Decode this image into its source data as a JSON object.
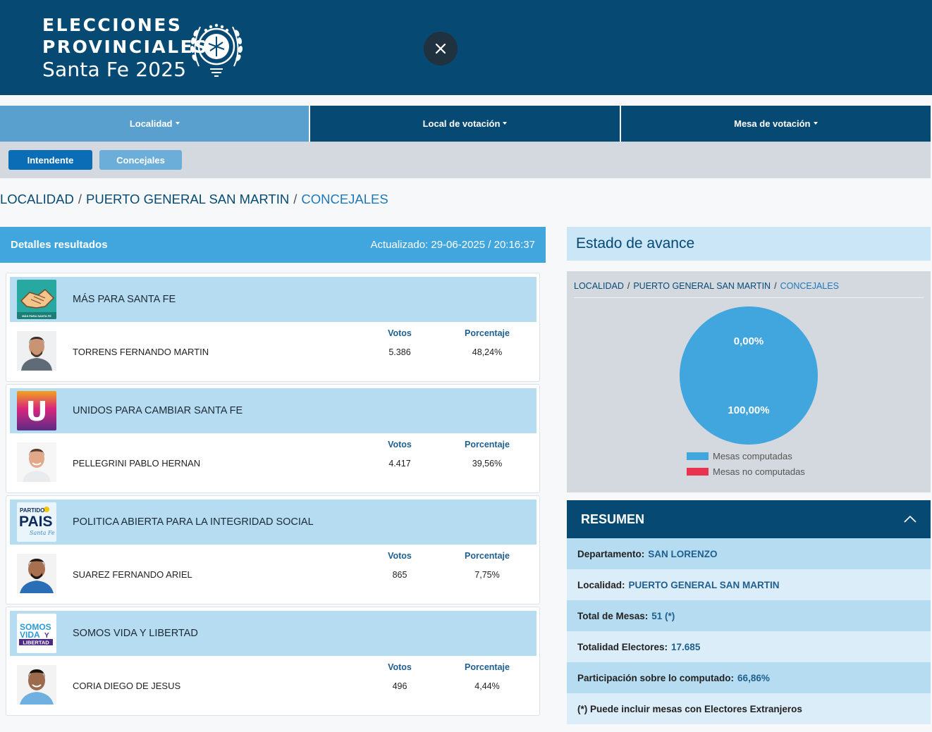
{
  "header": {
    "logo_line1": "ELECCIONES",
    "logo_line2": "PROVINCIALES",
    "logo_line3": "Santa Fe 2025"
  },
  "nav": {
    "tabs": [
      {
        "label": "Localidad"
      },
      {
        "label": "Local de votación"
      },
      {
        "label": "Mesa de votación"
      }
    ],
    "buttons": [
      {
        "label": "Intendente"
      },
      {
        "label": "Concejales"
      }
    ]
  },
  "breadcrumb": {
    "level1": "LOCALIDAD",
    "level2": "PUERTO GENERAL SAN MARTIN",
    "level3": "CONCEJALES"
  },
  "results": {
    "title": "Detalles resultados",
    "updated": "Actualizado: 29-06-2025 / 20:16:37",
    "votes_label": "Votos",
    "percent_label": "Porcentaje",
    "items": [
      {
        "party": "MÁS PARA SANTA FE",
        "candidate": "TORRENS FERNANDO MARTIN",
        "votes": "5.386",
        "percent": "48,24%"
      },
      {
        "party": "UNIDOS PARA CAMBIAR SANTA FE",
        "candidate": "PELLEGRINI PABLO HERNAN",
        "votes": "4.417",
        "percent": "39,56%"
      },
      {
        "party": "POLITICA ABIERTA PARA LA INTEGRIDAD SOCIAL",
        "candidate": "SUAREZ FERNANDO ARIEL",
        "votes": "865",
        "percent": "7,75%"
      },
      {
        "party": "SOMOS VIDA Y LIBERTAD",
        "candidate": "CORIA DIEGO DE JESUS",
        "votes": "496",
        "percent": "4,44%"
      }
    ]
  },
  "logos": {
    "mas_small": "MÁS PARA SANTA FE",
    "unidos_letter": "U",
    "pais_top": "PARTIDO",
    "pais_main": "PAIS",
    "pais_script": "Santa Fe",
    "somos_line1": "SOMOS",
    "somos_line2": "VIDA",
    "somos_y": "Y",
    "somos_line3": "LIBERTAD"
  },
  "avance": {
    "title": "Estado de avance",
    "breadcrumb": {
      "level1": "LOCALIDAD",
      "level2": "PUERTO GENERAL SAN MARTIN",
      "level3": "CONCEJALES"
    },
    "pie_label_top": "0,00%",
    "pie_label_bottom": "100,00%",
    "legend": [
      {
        "label": "Mesas computadas",
        "color": "#41a5de"
      },
      {
        "label": "Mesas no computadas",
        "color": "#e8344e"
      }
    ]
  },
  "chart_data": {
    "type": "pie",
    "categories": [
      "Mesas computadas",
      "Mesas no computadas"
    ],
    "values": [
      100.0,
      0.0
    ],
    "colors": [
      "#41a5de",
      "#e8344e"
    ],
    "legend_position": "bottom"
  },
  "resumen": {
    "title": "RESUMEN",
    "rows": [
      {
        "label": "Departamento:",
        "value": "SAN LORENZO"
      },
      {
        "label": "Localidad:",
        "value": "PUERTO GENERAL SAN MARTIN"
      },
      {
        "label": "Total de Mesas:",
        "value": "51 (*)"
      },
      {
        "label": "Totalidad Electores:",
        "value": "17.685"
      },
      {
        "label": "Participación sobre lo computado:",
        "value": "66,86%"
      }
    ],
    "note": "(*) Puede incluir mesas con Electores Extranjeros"
  },
  "colors": {
    "header_bg": "#064a74",
    "accent_blue": "#41a5de",
    "row_blue": "#b6dcf1",
    "not_computed_red": "#e8344e"
  },
  "icons": [
    "close-icon",
    "provincial-emblem",
    "chevron-up-icon",
    "caret-down-icon"
  ]
}
